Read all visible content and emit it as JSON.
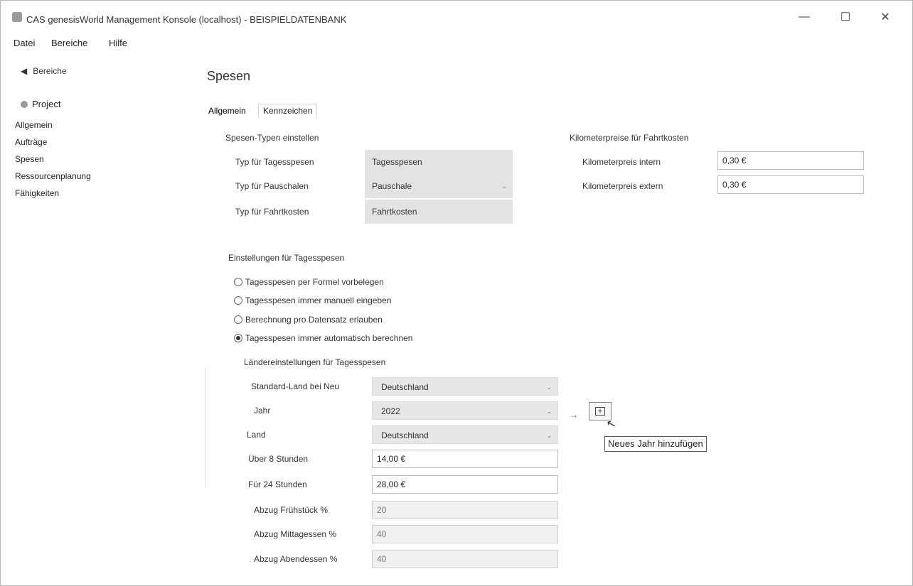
{
  "window": {
    "title": "CAS genesisWorld Management Konsole (localhost) - BEISPIELDATENBANK",
    "controls": {
      "minimize": "—",
      "maximize": "☐",
      "close": "✕"
    }
  },
  "menu": [
    "Datei",
    "Bereiche",
    "Hilfe"
  ],
  "sidebar": {
    "back_label": "Bereiche",
    "project_label": "Project",
    "items": [
      "Allgemein",
      "Aufträge",
      "Spesen",
      "Ressourcenplanung",
      "Fähigkeiten"
    ]
  },
  "page": {
    "title": "Spesen",
    "tabs": [
      "Allgemein",
      "Kennzeichen"
    ]
  },
  "spesen_typen": {
    "heading": "Spesen-Typen einstellen",
    "rows": [
      {
        "label": "Typ für Tagesspesen",
        "value": "Tagesspesen"
      },
      {
        "label": "Typ für Pauschalen",
        "value": "Pauschale"
      },
      {
        "label": "Typ für Fahrtkosten",
        "value": "Fahrtkosten"
      }
    ]
  },
  "kilometer": {
    "heading": "Kilometerpreise für Fahrtkosten",
    "rows": [
      {
        "label": "Kilometerpreis intern",
        "value": "0,30 €"
      },
      {
        "label": "Kilometerpreis extern",
        "value": "0,30 €"
      }
    ]
  },
  "tagesspesen": {
    "heading": "Einstellungen für Tagesspesen",
    "options": [
      {
        "label": "Tagesspesen per Formel vorbelegen",
        "selected": false
      },
      {
        "label": "Tagesspesen immer manuell eingeben",
        "selected": false
      },
      {
        "label": "Berechnung pro Datensatz erlauben",
        "selected": false
      },
      {
        "label": "Tagesspesen immer automatisch berechnen",
        "selected": true
      }
    ]
  },
  "laender": {
    "heading": "Ländereinstellungen für Tagesspesen",
    "standard_land": {
      "label": "Standard-Land bei Neu",
      "value": "Deutschland"
    },
    "jahr": {
      "label": "Jahr",
      "value": "2022"
    },
    "land": {
      "label": "Land",
      "value": "Deutschland"
    },
    "ueber8": {
      "label": "Über 8 Stunden",
      "value": "14,00 €"
    },
    "fuer24": {
      "label": "Für 24 Stunden",
      "value": "28,00 €"
    },
    "fruehstueck": {
      "label": "Abzug Frühstück %",
      "value": "20"
    },
    "mittag": {
      "label": "Abzug Mittagessen %",
      "value": "40"
    },
    "abend": {
      "label": "Abzug Abendessen %",
      "value": "40"
    },
    "add_tooltip": "Neues Jahr hinzufügen",
    "arrow": "→"
  }
}
